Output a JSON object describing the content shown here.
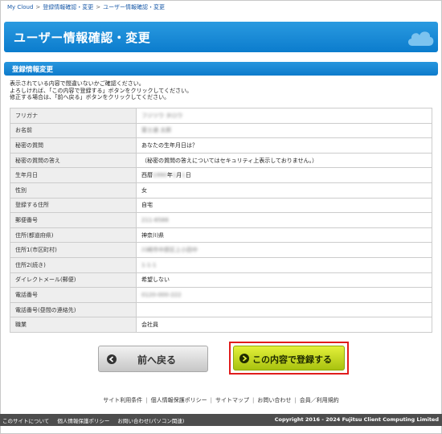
{
  "breadcrumb": {
    "items": [
      "My Cloud",
      "登録情報確認・変更",
      "ユーザー情報確認・変更"
    ],
    "separator": ">"
  },
  "title": "ユーザー情報確認・変更",
  "section": {
    "title": "登録情報変更"
  },
  "intro": {
    "line1": "表示されている内容で間違いないかご確認ください。",
    "line2": "よろしければ、「この内容で登録する」ボタンをクリックしてください。",
    "line3": "修正する場合は、「前へ戻る」ボタンをクリックしてください。"
  },
  "rows": [
    {
      "label": "フリガナ",
      "value": "フジツウ タロウ",
      "blurred": true
    },
    {
      "label": "お名前",
      "value": "富士通 太郎",
      "blurred": true
    },
    {
      "label": "秘密の質問",
      "value": "あなたの生年月日は？",
      "blurred": false
    },
    {
      "label": "秘密の質問の答え",
      "value": "（秘密の質問の答えについてはセキュリティ上表示しておりません。）",
      "blurred": false
    },
    {
      "label": "生年月日",
      "value_prefix": "西暦",
      "value_year": "1990",
      "value_mid": "年",
      "value_month": "1",
      "value_suffix": "月",
      "value_day": "1",
      "value_end": "日",
      "blurred": "partial"
    },
    {
      "label": "性別",
      "value": "女",
      "blurred": false
    },
    {
      "label": "登録する住所",
      "value": "自宅",
      "blurred": false
    },
    {
      "label": "郵便番号",
      "value": "211-8588",
      "blurred": true
    },
    {
      "label": "住所(都道府県)",
      "value": "神奈川県",
      "blurred": false
    },
    {
      "label": "住所1(市区町村)",
      "value": "川崎市中原区上小田中",
      "blurred": true
    },
    {
      "label": "住所2(続き)",
      "value": "1-1-1",
      "blurred": true
    },
    {
      "label": "ダイレクトメール(郵便)",
      "value": "希望しない",
      "blurred": false
    },
    {
      "label": "電話番号",
      "value": "0120-000-222",
      "blurred": true
    },
    {
      "label": "電話番号(昼間の連絡先)",
      "value": "",
      "blurred": false
    },
    {
      "label": "職業",
      "value": "会社員",
      "blurred": false
    }
  ],
  "buttons": {
    "back": "前へ戻る",
    "confirm": "この内容で登録する"
  },
  "footer": {
    "links": [
      "サイト利用条件",
      "個人情報保護ポリシー",
      "サイトマップ",
      "お問い合わせ",
      "会員／利用規約"
    ],
    "bottom_links": [
      "このサイトについて",
      "個人情報保護ポリシー",
      "お問い合わせ(パソコン関連)"
    ],
    "copyright": "Copyright 2016 - 2024 Fujitsu Client Computing Limited"
  },
  "colors": {
    "accent_blue": "#0b7ccd",
    "confirm_green": "#c6dc24",
    "highlight_red": "#e01c1c",
    "footer_bg": "#4d4d4d"
  }
}
